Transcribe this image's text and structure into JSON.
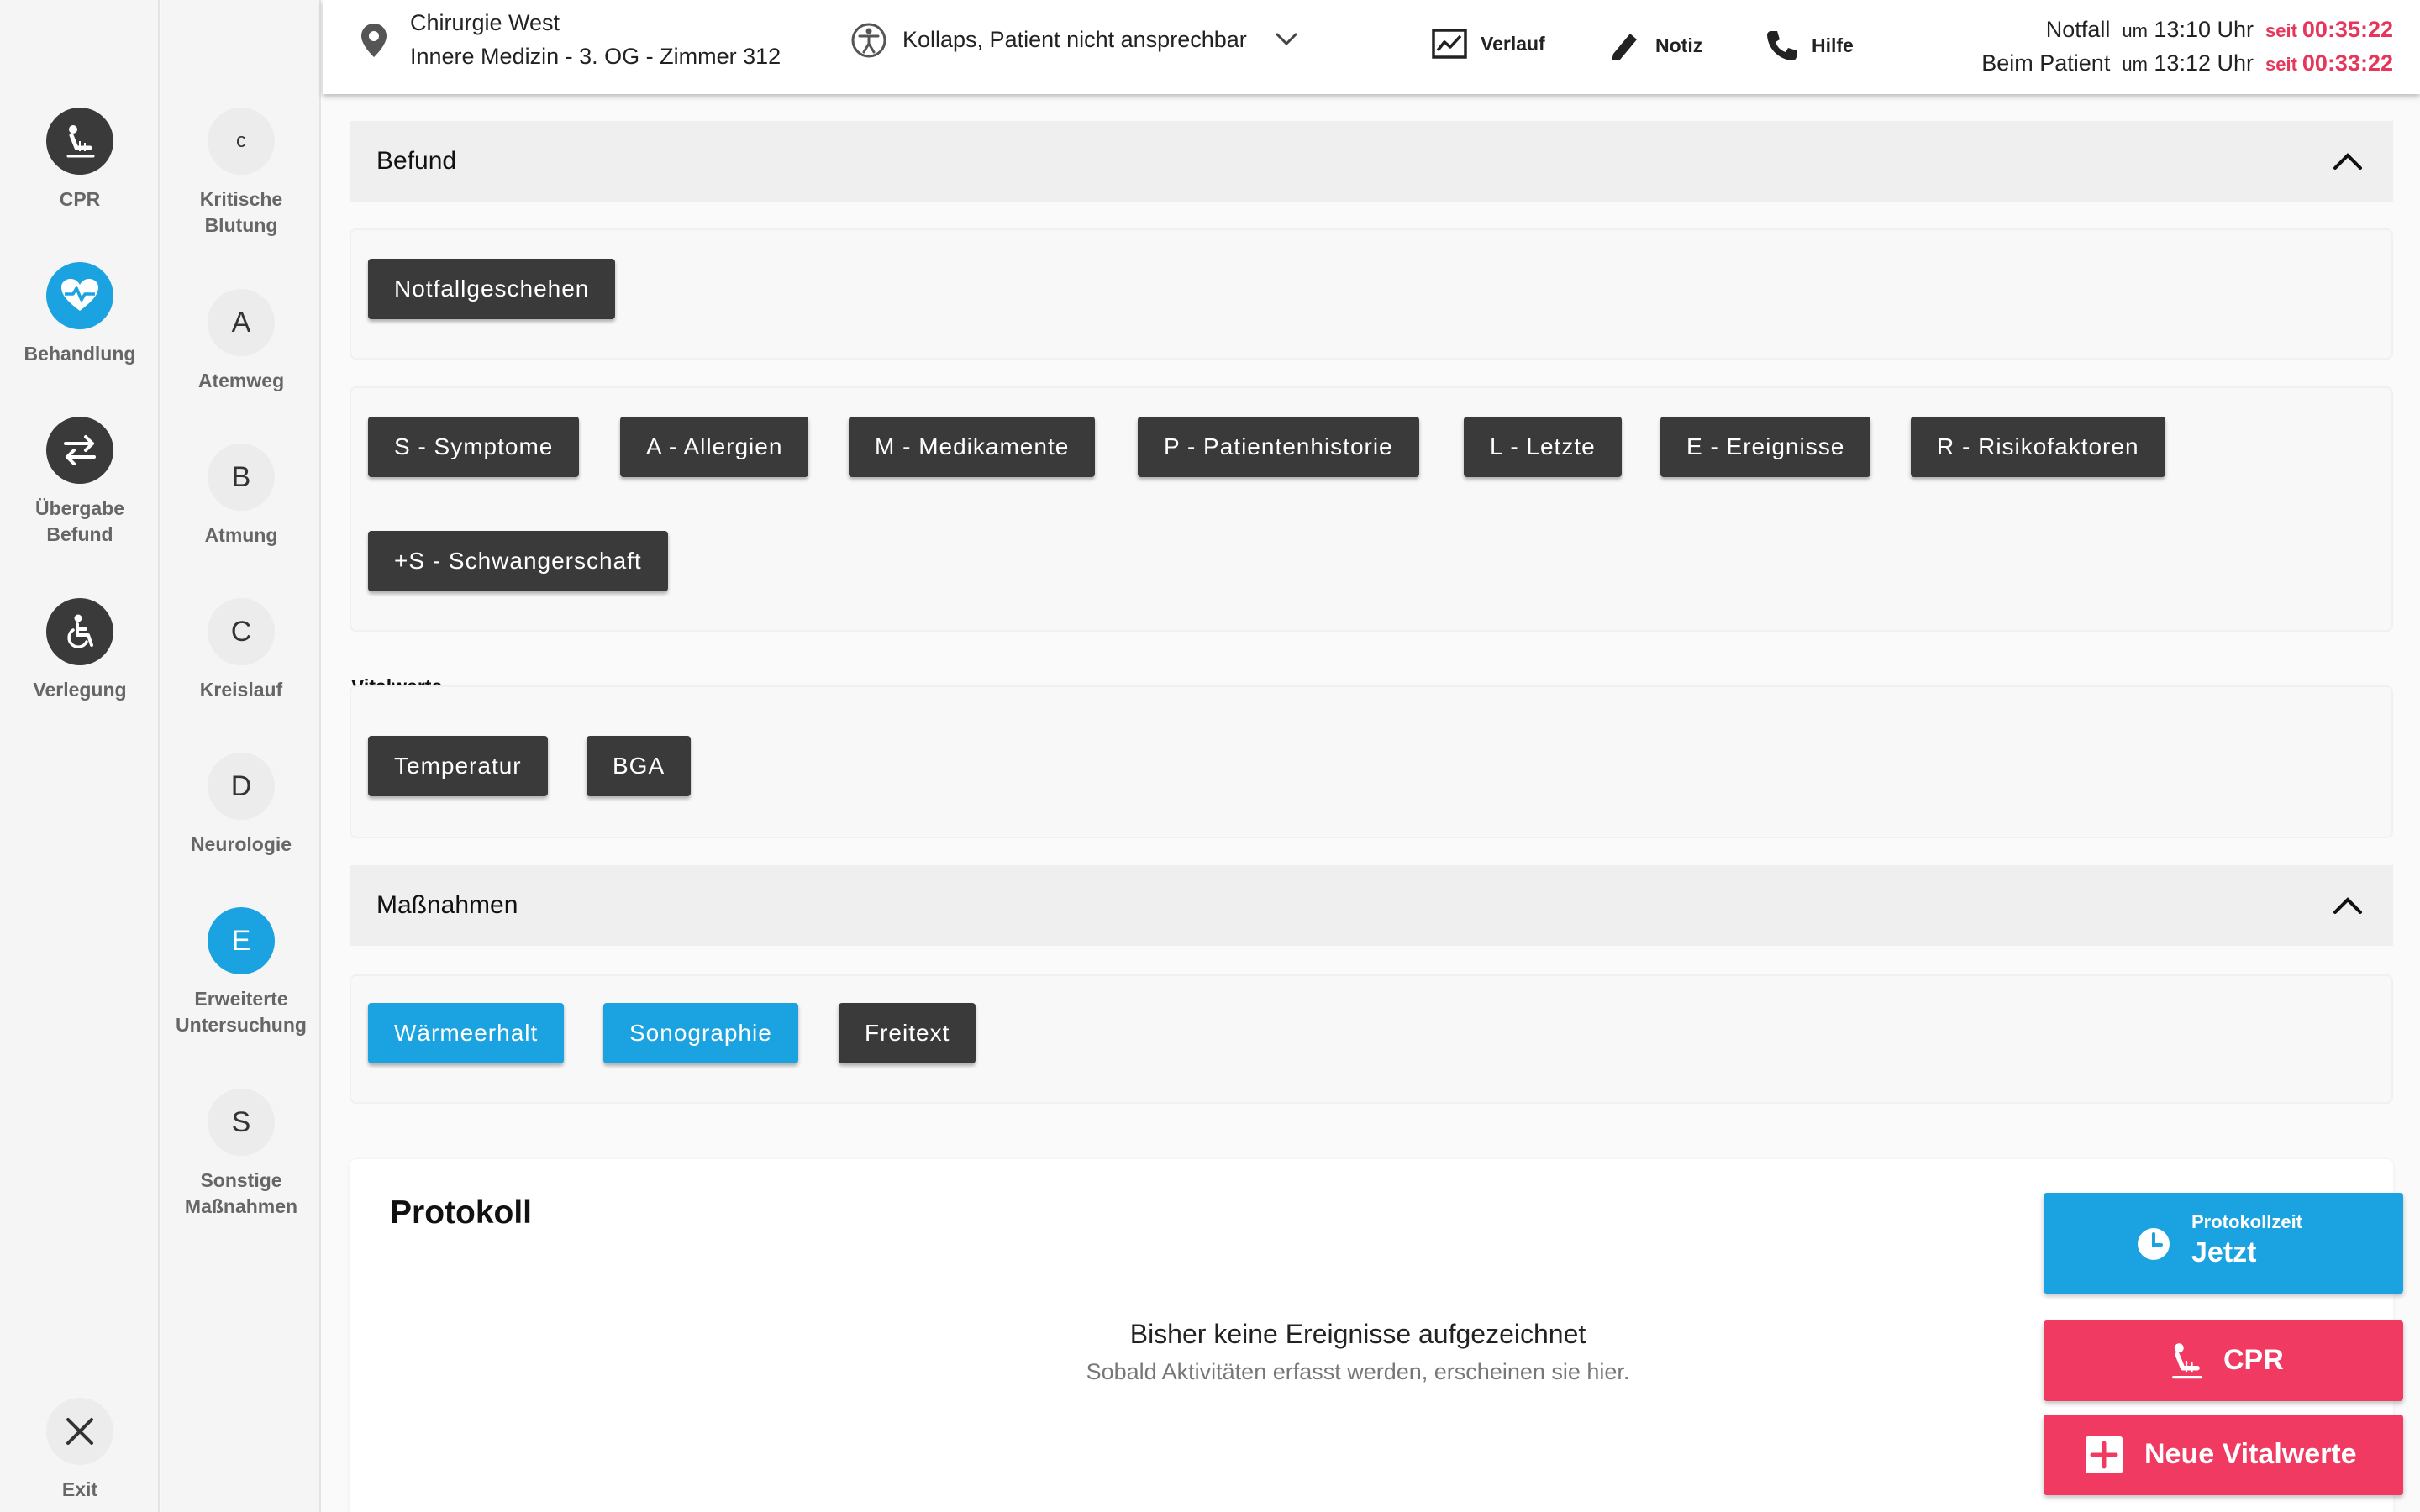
{
  "rail": {
    "items": [
      {
        "label": "CPR",
        "icon": "cpr-icon"
      },
      {
        "label": "Behandlung",
        "icon": "heart-pulse-icon"
      },
      {
        "label": "Übergabe Befund",
        "icon": "swap-arrows-icon"
      },
      {
        "label": "Verlegung",
        "icon": "wheelchair-icon"
      }
    ],
    "exit_label": "Exit"
  },
  "abcde": {
    "items": [
      {
        "letter": "c",
        "label": "Kritische Blutung"
      },
      {
        "letter": "A",
        "label": "Atemweg"
      },
      {
        "letter": "B",
        "label": "Atmung"
      },
      {
        "letter": "C",
        "label": "Kreislauf"
      },
      {
        "letter": "D",
        "label": "Neurologie"
      },
      {
        "letter": "E",
        "label": "Erweiterte Untersuchung"
      },
      {
        "letter": "S",
        "label": "Sonstige Maßnahmen"
      }
    ],
    "active_index": 5
  },
  "topbar": {
    "location_line1": "Chirurgie West",
    "location_line2": "Innere Medizin - 3. OG - Zimmer 312",
    "case_text": "Kollaps, Patient nicht ansprechbar",
    "verlauf_label": "Verlauf",
    "notiz_label": "Notiz",
    "hilfe_label": "Hilfe",
    "notfall_label": "Notfall",
    "notfall_um": "um",
    "notfall_time": "13:10 Uhr",
    "notfall_seit": "seit",
    "notfall_duration": "00:35:22",
    "patient_label": "Beim Patient",
    "patient_um": "um",
    "patient_time": "13:12 Uhr",
    "patient_seit": "seit",
    "patient_duration": "00:33:22"
  },
  "befund": {
    "title": "Befund",
    "notfallgeschehen": "Notfallgeschehen",
    "sampler": [
      "S - Symptome",
      "A - Allergien",
      "M - Medikamente",
      "P - Patientenhistorie",
      "L - Letzte",
      "E - Ereignisse",
      "R - Risikofaktoren",
      "+S - Schwangerschaft"
    ],
    "vitalwerte_label": "Vitalwerte",
    "vitalwerte": [
      "Temperatur",
      "BGA"
    ]
  },
  "massnahmen": {
    "title": "Maßnahmen",
    "items": [
      "Wärmeerhalt",
      "Sonographie",
      "Freitext"
    ]
  },
  "protokoll": {
    "title": "Protokoll",
    "empty_title": "Bisher keine Ereignisse aufgezeichnet",
    "empty_sub": "Sobald Aktivitäten erfasst werden, erscheinen sie hier."
  },
  "fabs": {
    "protokollzeit_label": "Protokollzeit",
    "protokollzeit_value": "Jetzt",
    "cpr_label": "CPR",
    "vitalwerte_label": "Neue Vitalwerte"
  },
  "colors": {
    "accent_blue": "#1aa3e0",
    "alert_red": "#f03a62",
    "chip_dark": "#3a3a3a"
  }
}
